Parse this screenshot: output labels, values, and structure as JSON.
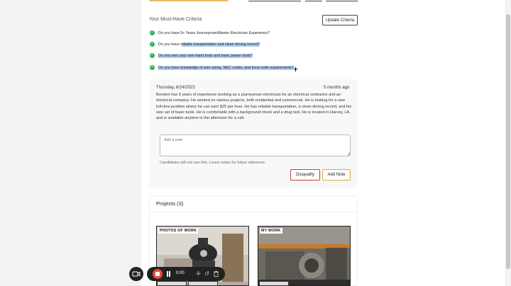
{
  "criteria": {
    "title": "Your Must-Have Criteria",
    "update_label": "Update Criteria",
    "items": [
      {
        "pre": "Do you have 5+ Years Journeyman/Master Electrician Experience?",
        "hl": ""
      },
      {
        "pre": "Do you have r",
        "hl": "eliable transportation and clean driving record?"
      },
      {
        "pre": "",
        "hl": "Do you own your own hand tools and basic power tools?"
      },
      {
        "pre": "",
        "hl": "Do you have knowledge of wire sizing, NEC codes, and local code requirements?"
      }
    ]
  },
  "note_card": {
    "date": "Thursday, 8/24/2023",
    "ago": "5 months ago",
    "summary": "Brenton has 5 years of experience working as a journeyman electrician for an electrical contractor and an electrical company. He worked on various projects, both residential and commercial. He is looking for a new full-time position where he can earn $25 per hour. He has reliable transportation, a clean driving record, and his own set of basic tools. He is comfortable with a background check and a drug test. He is located in Harvey, LA, and is available anytime in the afternoon for a call.",
    "note_placeholder": "Add a note",
    "note_hint": "Candidates will not see this. Leave notes for future reference.",
    "disqualify_label": "Disqualify",
    "add_note_label": "Add Note"
  },
  "projects": {
    "title": "Projects (3)",
    "photos": [
      {
        "tag": "PHOTOS OF WORK"
      },
      {
        "tag": "MY WORK"
      }
    ]
  },
  "recorder": {
    "timer": "0:00"
  },
  "icons": {
    "check": "check-circle-icon",
    "camera": "video-camera-icon",
    "stop": "stop-icon",
    "pause": "pause-icon",
    "grid": "grid-icon",
    "restart": "restart-icon",
    "trash": "trash-icon"
  },
  "colors": {
    "check_green": "#2fb35b",
    "highlight": "#b4cff0",
    "disqualify_border": "#cc3a3a",
    "add_note_border": "#e0a93a",
    "stop_red": "#e84a3c"
  }
}
